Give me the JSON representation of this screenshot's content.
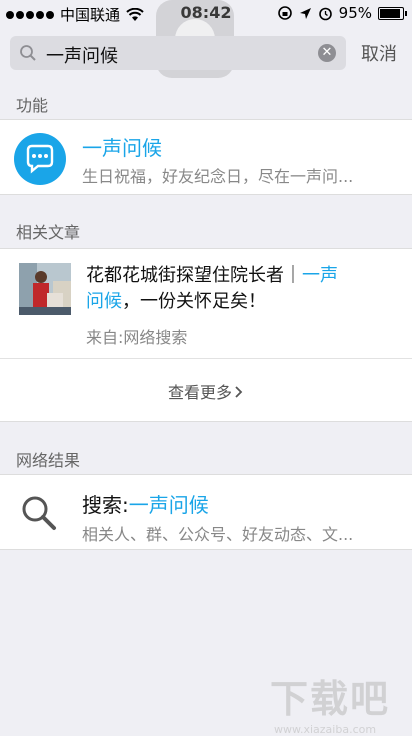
{
  "status_bar": {
    "carrier": "中国联通",
    "time": "08:42",
    "battery": "95%",
    "battery_level": 0.95
  },
  "search": {
    "query": "一声问候",
    "cancel_label": "取消"
  },
  "functions": {
    "section_label": "功能",
    "item": {
      "title": "一声问候",
      "description": "生日祝福，好友纪念日，尽在一声问...",
      "icon": "chat-bubble-icon",
      "icon_color": "#1aa5e8"
    }
  },
  "articles": {
    "section_label": "相关文章",
    "item": {
      "title_part1": "花都花城街探望住院长者｜",
      "title_highlight1": "一声",
      "title_highlight2": "问候",
      "title_part2": "，一份关怀足矣！",
      "source": "来自:网络搜索"
    },
    "more_label": "查看更多"
  },
  "web_results": {
    "section_label": "网络结果",
    "item": {
      "prefix": "搜索:",
      "query": "一声问候",
      "description": "相关人、群、公众号、好友动态、文..."
    }
  },
  "watermark": {
    "text": "下载吧",
    "url": "www.xiazaiba.com"
  },
  "colors": {
    "accent": "#1aa5e8",
    "background": "#efeff4"
  }
}
